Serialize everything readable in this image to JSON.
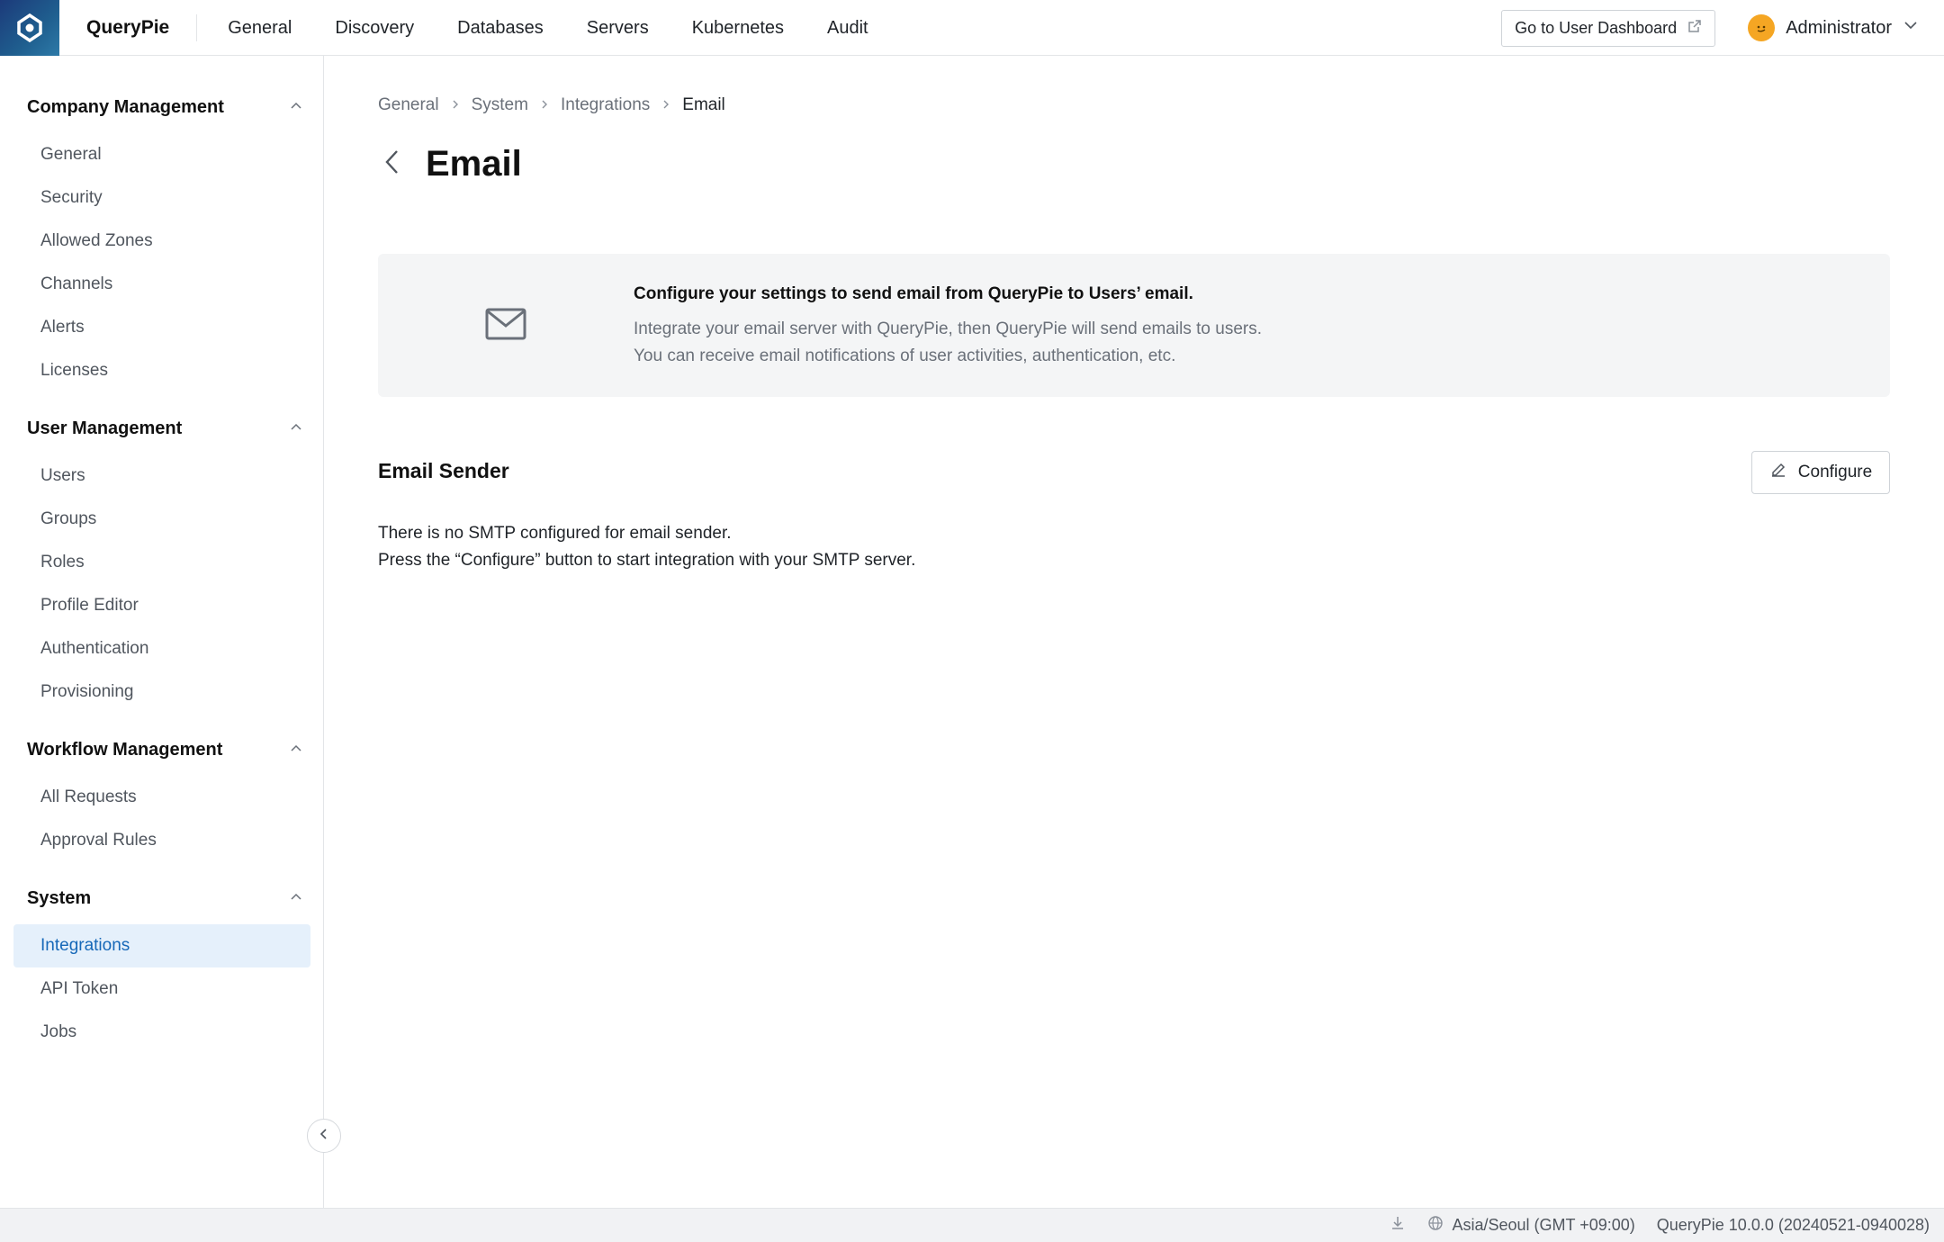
{
  "app": {
    "brand": "QueryPie"
  },
  "topnav": [
    "General",
    "Discovery",
    "Databases",
    "Servers",
    "Kubernetes",
    "Audit"
  ],
  "header": {
    "dashboard_label": "Go to User Dashboard",
    "user_name": "Administrator"
  },
  "sidebar": {
    "sections": [
      {
        "title": "Company Management",
        "items": [
          "General",
          "Security",
          "Allowed Zones",
          "Channels",
          "Alerts",
          "Licenses"
        ]
      },
      {
        "title": "User Management",
        "items": [
          "Users",
          "Groups",
          "Roles",
          "Profile Editor",
          "Authentication",
          "Provisioning"
        ]
      },
      {
        "title": "Workflow Management",
        "items": [
          "All Requests",
          "Approval Rules"
        ]
      },
      {
        "title": "System",
        "items": [
          "Integrations",
          "API Token",
          "Jobs"
        ]
      }
    ],
    "active_item": "Integrations"
  },
  "breadcrumb": [
    "General",
    "System",
    "Integrations",
    "Email"
  ],
  "page": {
    "title": "Email"
  },
  "info": {
    "title": "Configure your settings to send email from QueryPie to Users’ email.",
    "line1": "Integrate your email server with QueryPie, then QueryPie will send emails to users.",
    "line2": "You can receive email notifications of user activities, authentication, etc."
  },
  "sender": {
    "title": "Email Sender",
    "configure_label": "Configure",
    "line1": "There is no SMTP configured for email sender.",
    "line2": "Press the “Configure” button to start integration with your SMTP server."
  },
  "footer": {
    "timezone": "Asia/Seoul (GMT +09:00)",
    "version": "QueryPie 10.0.0 (20240521-0940028)"
  }
}
